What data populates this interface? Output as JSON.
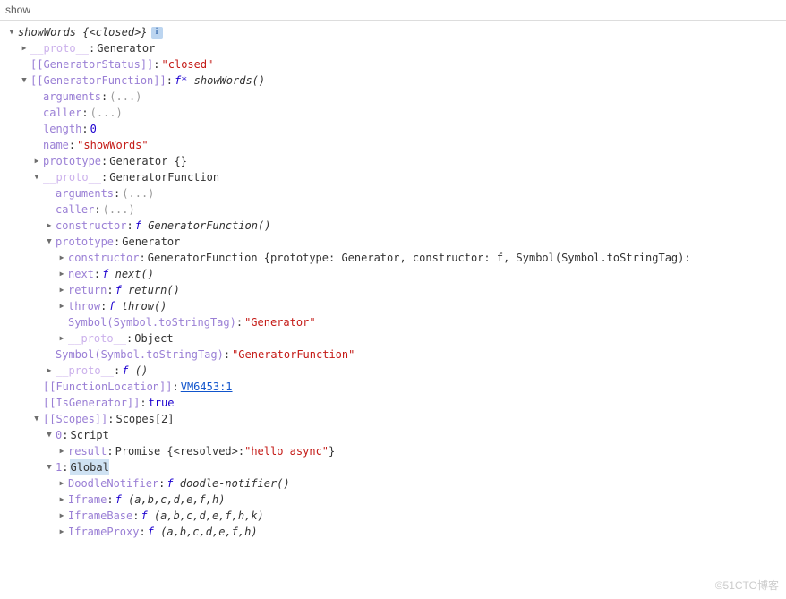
{
  "header": {
    "title": "show"
  },
  "root": {
    "name": "showWords",
    "suffix": "{<closed>}",
    "info_glyph": "i"
  },
  "rows": {
    "proto1": {
      "key": "__proto__",
      "val": "Generator"
    },
    "genStatus": {
      "key": "[[GeneratorStatus]]",
      "val": "\"closed\""
    },
    "genFunc": {
      "key": "[[GeneratorFunction]]",
      "f": "f*",
      "sig": "showWords()"
    },
    "arguments1": {
      "key": "arguments",
      "val": "(...)"
    },
    "caller1": {
      "key": "caller",
      "val": "(...)"
    },
    "length1": {
      "key": "length",
      "val": "0"
    },
    "name1": {
      "key": "name",
      "val": "\"showWords\""
    },
    "prototype1": {
      "key": "prototype",
      "val": "Generator {}"
    },
    "proto2": {
      "key": "__proto__",
      "val": "GeneratorFunction"
    },
    "arguments2": {
      "key": "arguments",
      "val": "(...)"
    },
    "caller2": {
      "key": "caller",
      "val": "(...)"
    },
    "constructor1": {
      "key": "constructor",
      "f": "f",
      "sig": "GeneratorFunction()"
    },
    "prototype2": {
      "key": "prototype",
      "val": "Generator"
    },
    "constructor2": {
      "key": "constructor",
      "val": "GeneratorFunction {prototype: Generator, constructor: f, Symbol(Symbol.toStringTag):"
    },
    "next": {
      "key": "next",
      "f": "f",
      "sig": "next()"
    },
    "return": {
      "key": "return",
      "f": "f",
      "sig": "return()"
    },
    "throw": {
      "key": "throw",
      "f": "f",
      "sig": "throw()"
    },
    "symbolTag1": {
      "key": "Symbol(Symbol.toStringTag)",
      "val": "\"Generator\""
    },
    "proto3": {
      "key": "__proto__",
      "val": "Object"
    },
    "symbolTag2": {
      "key": "Symbol(Symbol.toStringTag)",
      "val": "\"GeneratorFunction\""
    },
    "proto4": {
      "key": "__proto__",
      "f": "f",
      "sig": "()"
    },
    "funcLoc": {
      "key": "[[FunctionLocation]]",
      "link": "VM6453:1"
    },
    "isGen": {
      "key": "[[IsGenerator]]",
      "val": "true"
    },
    "scopes": {
      "key": "[[Scopes]]",
      "val": "Scopes[2]"
    },
    "scope0": {
      "key": "0",
      "val": "Script"
    },
    "result": {
      "key": "result",
      "pre": "Promise {<resolved>: ",
      "str": "\"hello async\"",
      "post": "}"
    },
    "scope1": {
      "key": "1",
      "val": "Global"
    },
    "doodle": {
      "key": "DoodleNotifier",
      "f": "f",
      "sig": "doodle-notifier()"
    },
    "iframe": {
      "key": "Iframe",
      "f": "f",
      "sig": "(a,b,c,d,e,f,h)"
    },
    "iframeBase": {
      "key": "IframeBase",
      "f": "f",
      "sig": "(a,b,c,d,e,f,h,k)"
    },
    "iframeProxy": {
      "key": "IframeProxy",
      "f": "f",
      "sig": "(a,b,c,d,e,f,h)"
    }
  },
  "watermark": "©51CTO博客"
}
